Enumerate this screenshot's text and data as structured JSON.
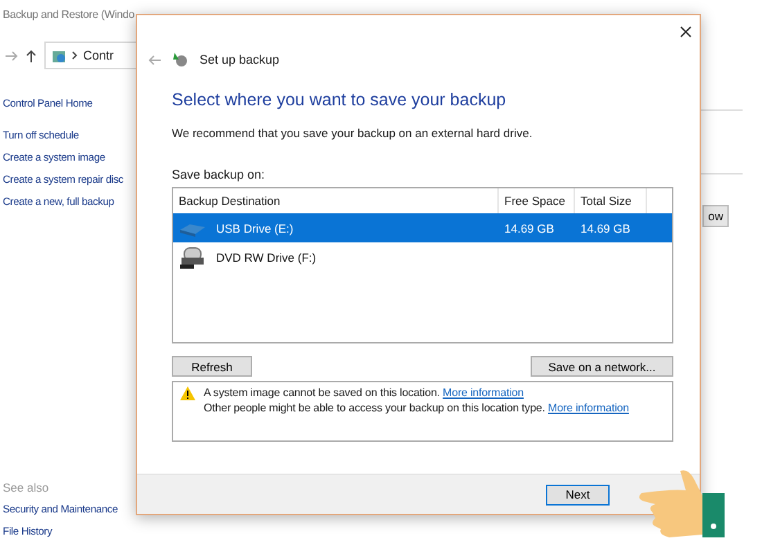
{
  "background_window": {
    "title": "Backup and Restore (Windo",
    "address": "Contr",
    "home_link": "Control Panel Home",
    "links": [
      "Turn off schedule",
      "Create a system image",
      "Create a system repair disc",
      "Create a new, full backup"
    ],
    "see_also": {
      "heading": "See also",
      "links": [
        "Security and Maintenance",
        "File History"
      ]
    },
    "button_fragment": "ow"
  },
  "dialog": {
    "title": "Set up backup",
    "heading": "Select where you want to save your backup",
    "description": "We recommend that you save your backup on an external hard drive.",
    "list_label": "Save backup on:",
    "columns": [
      "Backup Destination",
      "Free Space",
      "Total Size"
    ],
    "rows": [
      {
        "kind": "usb",
        "name": "USB Drive (E:)",
        "free_space": "14.69 GB",
        "total_size": "14.69 GB",
        "selected": true
      },
      {
        "kind": "dvd",
        "name": "DVD RW Drive (F:)",
        "selected": false
      }
    ],
    "refresh_button": "Refresh",
    "network_button": "Save on a network...",
    "notices": [
      {
        "text": "A system image cannot be saved on this location.",
        "link": "More information"
      },
      {
        "text": "Other people might be able to access your backup on this location type.",
        "link": "More information"
      }
    ],
    "buttons": [
      {
        "label": "Next",
        "default": true
      }
    ]
  }
}
